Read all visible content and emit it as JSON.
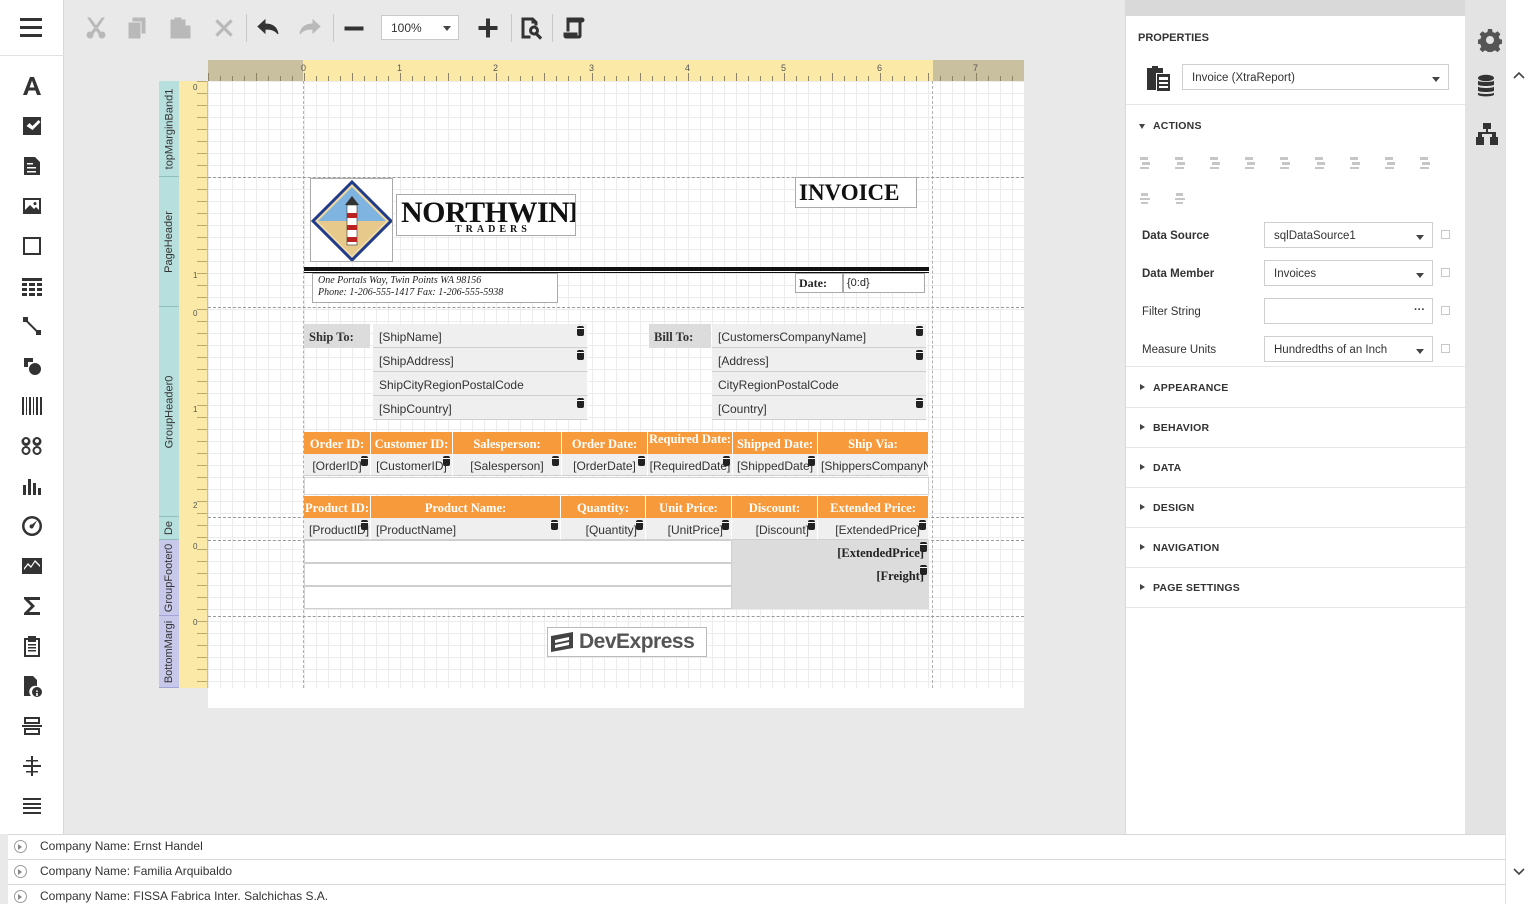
{
  "toolbar": {
    "zoom_value": "100%"
  },
  "bands": [
    "topMarginBand1",
    "PageHeader",
    "GroupHeader0",
    "De",
    "GroupFooter0",
    "BottomMargi"
  ],
  "ruler": {
    "h_numbers": [
      "0",
      "1",
      "2",
      "3",
      "4",
      "5",
      "6",
      "7"
    ],
    "v_numbers": [
      "0",
      "1",
      "0",
      "1",
      "2",
      "0",
      "0"
    ]
  },
  "report": {
    "company_name": "NORTHWIND",
    "company_sub": "TRADERS",
    "invoice_title": "INVOICE",
    "address_line1": "One Portals Way, Twin Points WA  98156",
    "address_line2": "Phone: 1-206-555-1417   Fax: 1-206-555-5938",
    "date_label": "Date:",
    "date_value": "{0:d}",
    "ship_to_label": "Ship To:",
    "ship_to_fields": [
      "[ShipName]",
      "[ShipAddress]",
      "ShipCityRegionPostalCode",
      "[ShipCountry]"
    ],
    "bill_to_label": "Bill To:",
    "bill_to_fields": [
      "[CustomersCompanyName]",
      "[Address]",
      "CityRegionPostalCode",
      "[Country]"
    ],
    "order_headers": [
      "Order ID:",
      "Customer ID:",
      "Salesperson:",
      "Order Date:",
      "Required Date:",
      "Shipped Date:",
      "Ship Via:"
    ],
    "order_values": [
      "[OrderID]",
      "[CustomerID]",
      "[Salesperson]",
      "[OrderDate]",
      "[RequiredDate]",
      "[ShippedDate]",
      "[ShippersCompanyName]"
    ],
    "product_headers": [
      "Product ID:",
      "Product Name:",
      "Quantity:",
      "Unit Price:",
      "Discount:",
      "Extended Price:"
    ],
    "product_values": [
      "[ProductID]",
      "[ProductName]",
      "[Quantity]",
      "[UnitPrice]",
      "[Discount]",
      "[ExtendedPrice]"
    ],
    "footer_values": [
      "[ExtendedPrice]",
      "[Freight]"
    ],
    "footer_logo": "DevExpress"
  },
  "properties": {
    "title": "PROPERTIES",
    "selected_component": "Invoice (XtraReport)",
    "actions_label": "ACTIONS",
    "rows": [
      {
        "name": "Data Source",
        "value": "sqlDataSource1",
        "bold": true
      },
      {
        "name": "Data Member",
        "value": "Invoices",
        "bold": true
      },
      {
        "name": "Filter String",
        "value": "",
        "bold": false
      },
      {
        "name": "Measure Units",
        "value": "Hundredths of an Inch",
        "bold": false
      }
    ],
    "ellipsis": "···",
    "sections": [
      "APPEARANCE",
      "BEHAVIOR",
      "DATA",
      "DESIGN",
      "NAVIGATION",
      "PAGE SETTINGS"
    ]
  },
  "bottom_list": [
    "Company Name: Ernst Handel",
    "Company Name: Familia Arquibaldo",
    "Company Name: FISSA Fabrica Inter. Salchichas S.A."
  ],
  "colors": {
    "header_orange": "#f79a3b",
    "band_teal": "#b7dfdd",
    "band_lavender": "#c8c9ea",
    "ruler_yellow": "#fbe9a8"
  }
}
